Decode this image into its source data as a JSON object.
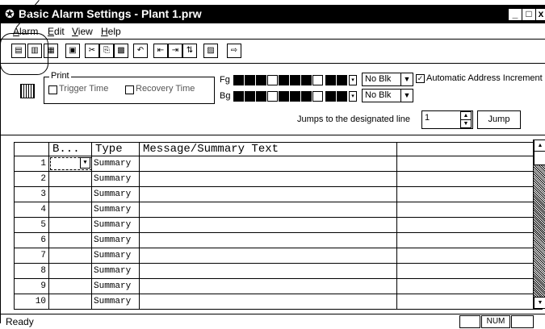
{
  "window": {
    "title": "Basic Alarm Settings - Plant 1.prw",
    "minimize": "_",
    "maximize": "□",
    "close": "x"
  },
  "menubar": {
    "items": [
      {
        "label": "Alarm",
        "accel": "A"
      },
      {
        "label": "Edit",
        "accel": "E"
      },
      {
        "label": "View",
        "accel": "V"
      },
      {
        "label": "Help",
        "accel": "H"
      }
    ]
  },
  "toolbar": {
    "buttons": [
      {
        "name": "basic-alarm-icon",
        "glyph": "▤"
      },
      {
        "name": "alarm-history-icon",
        "glyph": "▥"
      },
      {
        "name": "alarm-log-icon",
        "glyph": "▦"
      },
      {
        "name": "save-icon",
        "glyph": "▣"
      },
      {
        "name": "cut-icon",
        "glyph": "✂"
      },
      {
        "name": "copy-icon",
        "glyph": "⎘"
      },
      {
        "name": "paste-icon",
        "glyph": "▩"
      },
      {
        "name": "undo-icon",
        "glyph": "↶"
      },
      {
        "name": "insert-row-icon",
        "glyph": "⇤"
      },
      {
        "name": "delete-row-icon",
        "glyph": "⇥"
      },
      {
        "name": "sort-icon",
        "glyph": "⇅"
      },
      {
        "name": "properties-icon",
        "glyph": "▨"
      },
      {
        "name": "exit-icon",
        "glyph": "⇨"
      }
    ]
  },
  "print": {
    "legend": "Print",
    "trigger_time": "Trigger Time",
    "recovery_time": "Recovery Time"
  },
  "colors": {
    "fg_label": "Fg",
    "bg_label": "Bg",
    "fg_blink": "No Blk",
    "bg_blink": "No Blk",
    "fg_swatches": [
      "#000000",
      "#000000",
      "#000000",
      "#ffffff",
      "#000000",
      "#000000",
      "#000000",
      "#ffffff",
      "#000000",
      "#000000"
    ],
    "bg_swatches": [
      "#000000",
      "#000000",
      "#000000",
      "#ffffff",
      "#000000",
      "#000000",
      "#000000",
      "#ffffff",
      "#000000",
      "#000000"
    ]
  },
  "auto_increment": {
    "label": "Automatic Address Increment",
    "checked": true
  },
  "jump": {
    "label": "Jumps to the designated line",
    "value": "1",
    "button": "Jump"
  },
  "grid": {
    "headers": [
      "B...",
      "Type",
      "Message/Summary Text"
    ],
    "rows": [
      {
        "n": "1",
        "type": "Summary"
      },
      {
        "n": "2",
        "type": "Summary"
      },
      {
        "n": "3",
        "type": "Summary"
      },
      {
        "n": "4",
        "type": "Summary"
      },
      {
        "n": "5",
        "type": "Summary"
      },
      {
        "n": "6",
        "type": "Summary"
      },
      {
        "n": "7",
        "type": "Summary"
      },
      {
        "n": "8",
        "type": "Summary"
      },
      {
        "n": "9",
        "type": "Summary"
      },
      {
        "n": "10",
        "type": "Summary"
      }
    ]
  },
  "status": {
    "text": "Ready",
    "num": "NUM"
  }
}
